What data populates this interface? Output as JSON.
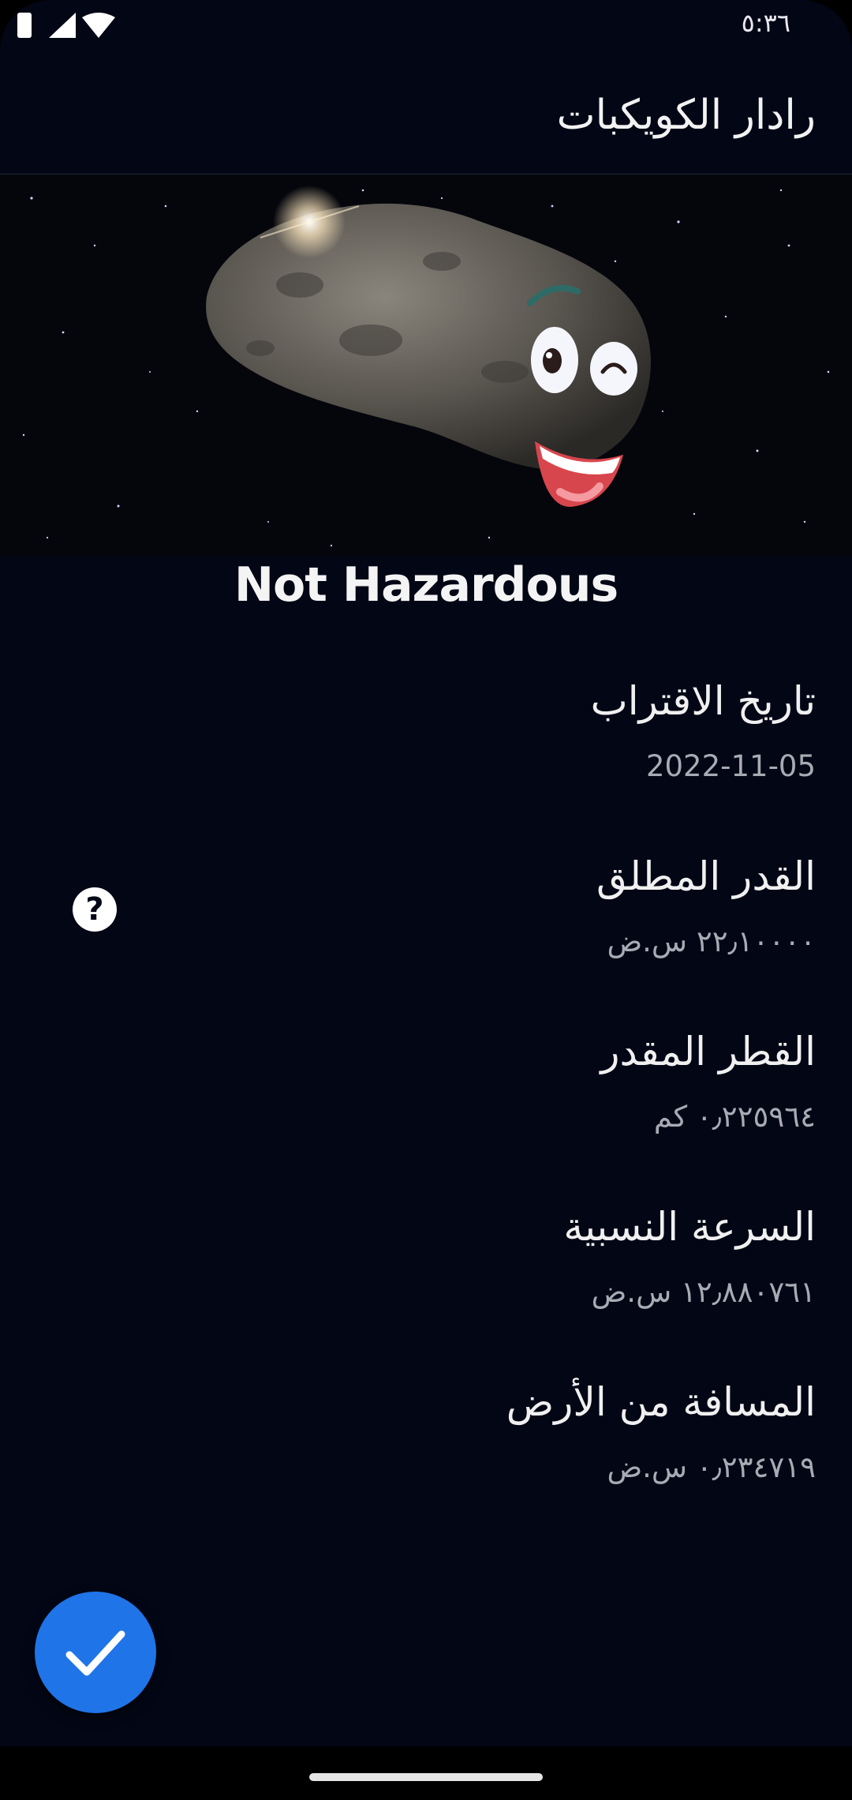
{
  "status_bar": {
    "time": "٥:٣٦"
  },
  "app_bar": {
    "title": "رادار الكويكبات"
  },
  "hero": {
    "hazard_status": "Not Hazardous"
  },
  "details": [
    {
      "label": "تاريخ الاقتراب",
      "value": "2022-11-05"
    },
    {
      "label": "القدر المطلق",
      "value": "٢٢٫١٠٠٠٠ س.ض"
    },
    {
      "label": "القطر المقدر",
      "value": "٠٫٢٢٥٩٦٤ كم"
    },
    {
      "label": "السرعة النسبية",
      "value": "١٢٫٨٨٠٧٦١ س.ض"
    },
    {
      "label": "المسافة من الأرض",
      "value": "٠٫٢٣٤٧١٩ س.ض"
    }
  ],
  "help": {
    "glyph": "?"
  },
  "icons": {
    "help": "help-circle-icon",
    "fab": "checkmark-icon",
    "wifi": "wifi-icon",
    "signal": "signal-icon",
    "battery": "battery-icon"
  },
  "colors": {
    "background": "#030615",
    "fab": "#1f74e8",
    "text": "#ffffff",
    "secondary_text": "#a8abb4"
  }
}
